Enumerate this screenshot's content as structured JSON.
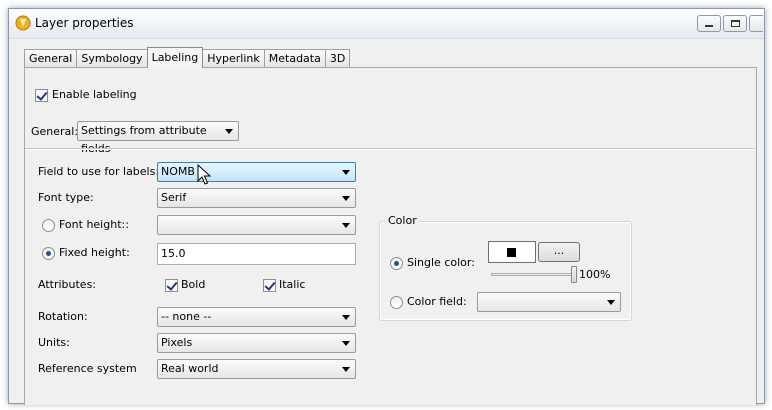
{
  "window": {
    "title": "Layer properties",
    "controls": {
      "minimize": "▭",
      "maximize": "▢",
      "close": ""
    }
  },
  "tabs": [
    {
      "label": "General"
    },
    {
      "label": "Symbology"
    },
    {
      "label": "Labeling",
      "active": true
    },
    {
      "label": "Hyperlink"
    },
    {
      "label": "Metadata"
    },
    {
      "label": "3D"
    }
  ],
  "labeling": {
    "enable_label": "Enable labeling",
    "enable_checked": true,
    "general_label": "General:",
    "general_value": "Settings from attribute fields",
    "field_label": "Field to use for labels:",
    "field_value": "NOMB",
    "font_type_label": "Font type:",
    "font_type_value": "Serif",
    "font_height_label": "Font height::",
    "font_height_value": "",
    "fixed_height_label": "Fixed height:",
    "fixed_height_value": "15.0",
    "attributes_label": "Attributes:",
    "bold_label": "Bold",
    "italic_label": "Italic",
    "rotation_label": "Rotation:",
    "rotation_value": "-- none --",
    "units_label": "Units:",
    "units_value": "Pixels",
    "refsys_label": "Reference system",
    "refsys_value": "Real world"
  },
  "color": {
    "group_title": "Color",
    "single_color_label": "Single color:",
    "swatch_color": "#000000",
    "browse_label": "...",
    "opacity_text": "100%",
    "opacity_level": 1.0,
    "color_field_label": "Color field:",
    "color_field_value": ""
  }
}
